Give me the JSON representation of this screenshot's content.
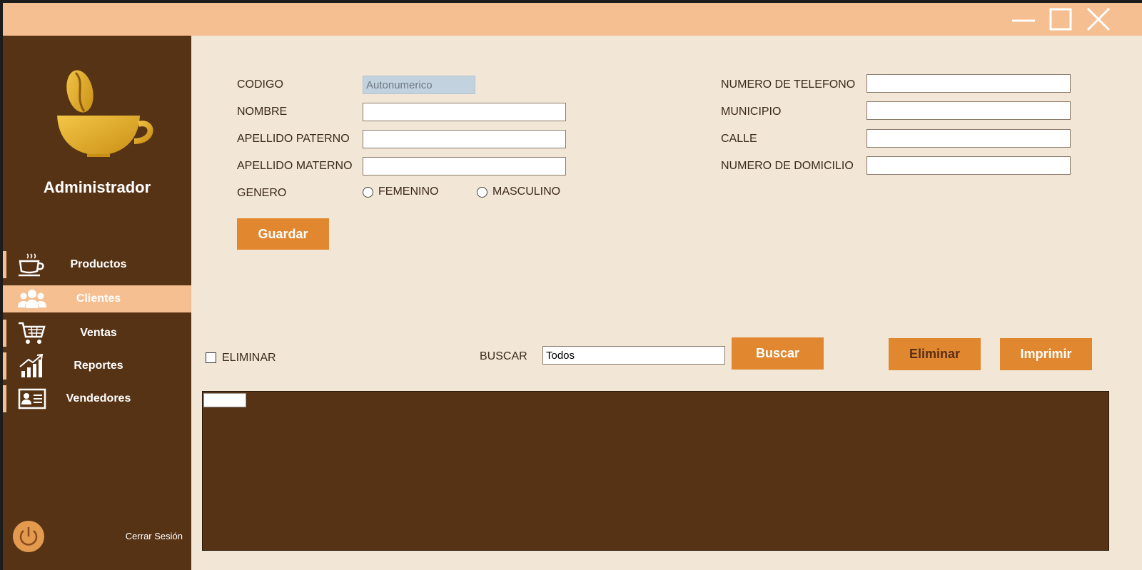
{
  "window": {
    "controls": {
      "minimize": "minimize-icon",
      "maximize": "maximize-icon",
      "close": "close-icon"
    }
  },
  "sidebar": {
    "title": "Administrador",
    "items": [
      {
        "label": "Productos",
        "icon": "coffee-cup-icon",
        "active": false
      },
      {
        "label": "Clientes",
        "icon": "users-icon",
        "active": true
      },
      {
        "label": "Ventas",
        "icon": "shopping-cart-icon",
        "active": false
      },
      {
        "label": "Reportes",
        "icon": "bar-chart-icon",
        "active": false
      },
      {
        "label": "Vendedores",
        "icon": "id-card-icon",
        "active": false
      }
    ],
    "logout_label": "Cerrar Sesión"
  },
  "form": {
    "left": {
      "codigo_label": "CODIGO",
      "codigo_value": "Autonumerico",
      "nombre_label": "NOMBRE",
      "nombre_value": "",
      "apellido_paterno_label": "APELLIDO PATERNO",
      "apellido_paterno_value": "",
      "apellido_materno_label": "APELLIDO MATERNO",
      "apellido_materno_value": "",
      "genero_label": "GENERO",
      "genero_options": [
        "FEMENINO",
        "MASCULINO"
      ]
    },
    "right": {
      "telefono_label": "NUMERO DE TELEFONO",
      "telefono_value": "",
      "municipio_label": "MUNICIPIO",
      "municipio_value": "",
      "calle_label": "CALLE",
      "calle_value": "",
      "domicilio_label": "NUMERO DE DOMICILIO",
      "domicilio_value": ""
    },
    "save_label": "Guardar"
  },
  "toolbar": {
    "eliminar_check_label": "ELIMINAR",
    "buscar_label": "BUSCAR",
    "buscar_value": "Todos",
    "search_button": "Buscar",
    "delete_button": "Eliminar",
    "print_button": "Imprimir"
  },
  "colors": {
    "sidebar_bg": "#573315",
    "accent": "#f5bf92",
    "button": "#e0872f",
    "content_bg": "#f2e6d7"
  }
}
